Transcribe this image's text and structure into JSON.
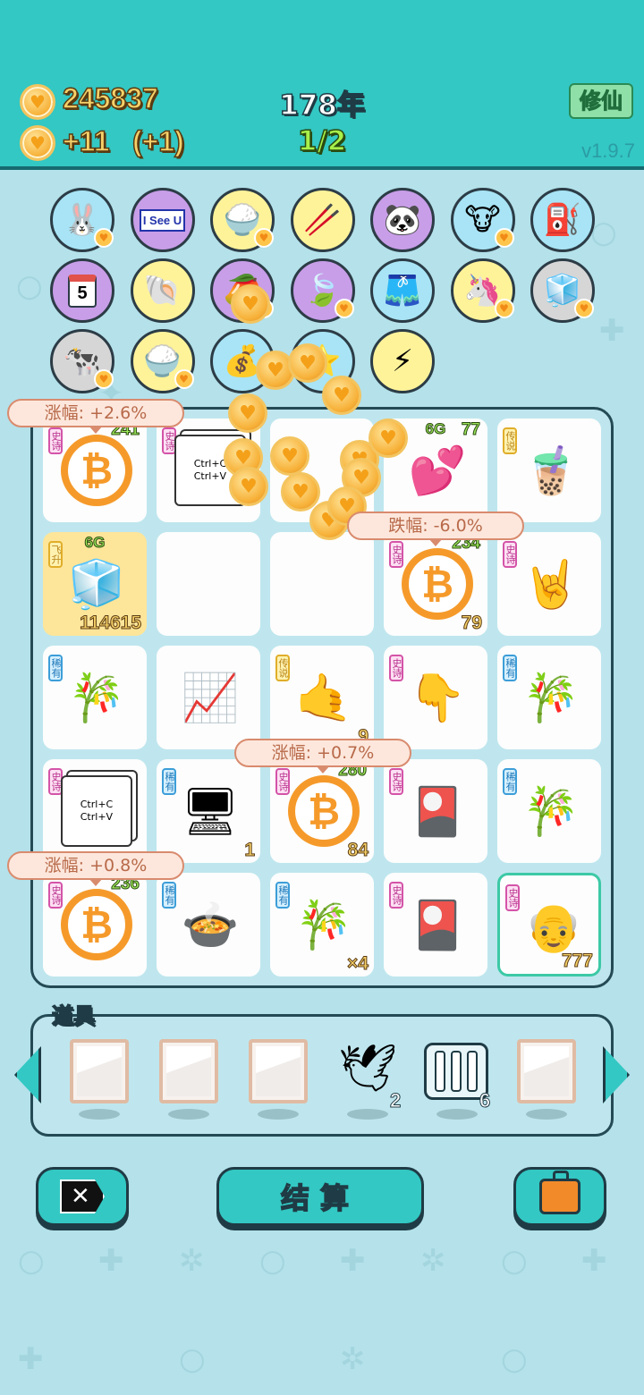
{
  "header": {
    "coins": "245837",
    "income": "+11",
    "income_bonus": "(+1)",
    "year": "178年",
    "progress": "1/2",
    "mode_label": "修仙",
    "version": "v1.9.7"
  },
  "collection": [
    {
      "icon": "bunny-icon",
      "glyph": "🐰"
    },
    {
      "icon": "i-see-u-sign-icon",
      "glyph": "I See U"
    },
    {
      "icon": "rice-bowl-icon",
      "glyph": "🍚"
    },
    {
      "icon": "chopsticks-icon",
      "glyph": "🥢"
    },
    {
      "icon": "panda-icon",
      "glyph": "🐼"
    },
    {
      "icon": "cow-twins-icon",
      "glyph": "🐮"
    },
    {
      "icon": "pump-icon",
      "glyph": "⛽"
    },
    {
      "icon": "calendar-icon",
      "glyph": "5"
    },
    {
      "icon": "shell-icon",
      "glyph": "🐚"
    },
    {
      "icon": "mango-icon",
      "glyph": "🥭"
    },
    {
      "icon": "leaf-icon",
      "glyph": "🍃"
    },
    {
      "icon": "skirt-icon",
      "glyph": "🩳"
    },
    {
      "icon": "unicorn-icon",
      "glyph": "🦄"
    },
    {
      "icon": "sugar-cubes-icon",
      "glyph": "🧊"
    },
    {
      "icon": "cow-duo-icon",
      "glyph": "🐄"
    },
    {
      "icon": "rice-bowl-icon",
      "glyph": "🍚"
    },
    {
      "icon": "money-bag-icon",
      "glyph": "💰"
    },
    {
      "icon": "star-icon",
      "glyph": "⭐"
    },
    {
      "icon": "lightning-icon",
      "glyph": "⚡"
    }
  ],
  "bubbles": {
    "b1": "涨幅: +2.6%",
    "b2": "跌幅: -6.0%",
    "b3": "涨幅: +0.7%",
    "b4": "涨幅: +0.8%"
  },
  "board": [
    {
      "tag": "史诗",
      "icon": "bitcoin-icon",
      "glyph": "₿",
      "top": "241"
    },
    {
      "tag": "史诗",
      "icon": "copy-paste-icon",
      "glyph": "Ctrl+C\nCtrl+V"
    },
    {
      "tag": "",
      "icon": "coin-pile-icon",
      "glyph": ""
    },
    {
      "tag": "",
      "icon": "hearts-crown-icon",
      "glyph": "💕",
      "level": "6G",
      "top": "77"
    },
    {
      "tag": "传说",
      "icon": "bubble-tea-icon",
      "glyph": "🧋"
    },
    {
      "tag": "飞升",
      "icon": "fridge-icon",
      "glyph": "🧊",
      "level": "6G",
      "val": "114615"
    },
    {
      "tag": "",
      "icon": "empty-icon",
      "glyph": ""
    },
    {
      "tag": "",
      "icon": "empty-icon",
      "glyph": ""
    },
    {
      "tag": "史诗",
      "icon": "bitcoin-icon",
      "glyph": "₿",
      "top": "234",
      "val": "79"
    },
    {
      "tag": "史诗",
      "icon": "rock-hand-icon",
      "glyph": "🤘"
    },
    {
      "tag": "稀有",
      "icon": "bamboo-icon",
      "glyph": "🎋"
    },
    {
      "tag": "",
      "icon": "stock-chart-icon",
      "glyph": "📈"
    },
    {
      "tag": "传说",
      "icon": "gold-hand-icon",
      "glyph": "🤙",
      "val": "9"
    },
    {
      "tag": "史诗",
      "icon": "pointing-hand-icon",
      "glyph": "👇"
    },
    {
      "tag": "稀有",
      "icon": "bamboo-icon",
      "glyph": "🎋"
    },
    {
      "tag": "史诗",
      "icon": "copy-paste-icon",
      "glyph": "Ctrl+C\nCtrl+V"
    },
    {
      "tag": "稀有",
      "icon": "pc-tower-icon",
      "glyph": "🖥",
      "val": "1"
    },
    {
      "tag": "史诗",
      "icon": "bitcoin-icon",
      "glyph": "₿",
      "top": "280",
      "val": "84"
    },
    {
      "tag": "史诗",
      "icon": "graphics-card-icon",
      "glyph": "🎴"
    },
    {
      "tag": "稀有",
      "icon": "bamboo-icon",
      "glyph": "🎋"
    },
    {
      "tag": "史诗",
      "icon": "bitcoin-icon",
      "glyph": "₿",
      "top": "236"
    },
    {
      "tag": "稀有",
      "icon": "pressure-cooker-icon",
      "glyph": "🍲"
    },
    {
      "tag": "稀有",
      "icon": "bamboo-icon",
      "glyph": "🎋",
      "val": "×4"
    },
    {
      "tag": "史诗",
      "icon": "graphics-card-icon",
      "glyph": "🎴"
    },
    {
      "tag": "史诗",
      "icon": "old-man-face-icon",
      "glyph": "👴",
      "val": "777"
    }
  ],
  "tools": {
    "title": "道具",
    "bird_count": "2",
    "cage_count": "6"
  },
  "buttons": {
    "settle": "结算"
  }
}
